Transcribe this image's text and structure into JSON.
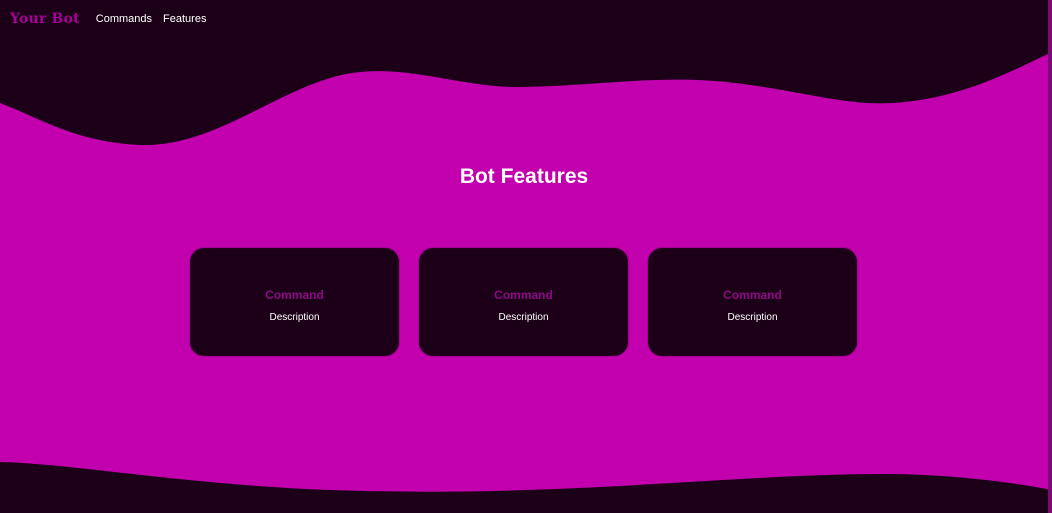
{
  "navbar": {
    "brand": "Your Bot",
    "links": [
      "Commands",
      "Features"
    ]
  },
  "features": {
    "title": "Bot Features",
    "cards": [
      {
        "title": "Command",
        "description": "Description"
      },
      {
        "title": "Command",
        "description": "Description"
      },
      {
        "title": "Command",
        "description": "Description"
      }
    ]
  },
  "colors": {
    "background_dark": "#1b0018",
    "accent_magenta": "#c200ae",
    "brand_purple": "#a8009a",
    "card_title": "#8f0a86",
    "text_white": "#ffffff"
  }
}
